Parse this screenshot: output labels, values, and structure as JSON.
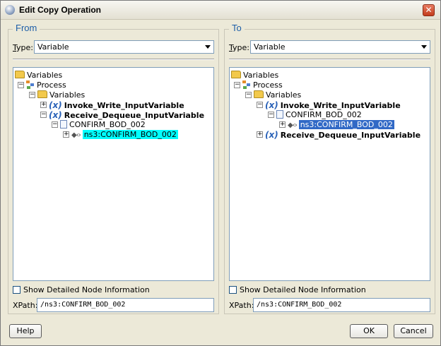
{
  "window": {
    "title": "Edit Copy Operation",
    "close_glyph": "✕"
  },
  "from": {
    "title": "From",
    "type_label": "Type:",
    "type_value": "Variable",
    "tree": {
      "variables_root": "Variables",
      "process": "Process",
      "variables": "Variables",
      "var1": "Invoke_Write_InputVariable",
      "var2": "Receive_Dequeue_InputVariable",
      "doc": "CONFIRM_BOD_002",
      "element": "ns3:CONFIRM_BOD_002"
    },
    "show_details_label": "Show Detailed Node Information",
    "xpath_label": "XPath:",
    "xpath_value": "/ns3:CONFIRM_BOD_002"
  },
  "to": {
    "title": "To",
    "type_label": "Type:",
    "type_value": "Variable",
    "tree": {
      "variables_root": "Variables",
      "process": "Process",
      "variables": "Variables",
      "var1": "Invoke_Write_InputVariable",
      "doc": "CONFIRM_BOD_002",
      "element": "ns3:CONFIRM_BOD_002",
      "var2": "Receive_Dequeue_InputVariable"
    },
    "show_details_label": "Show Detailed Node Information",
    "xpath_label": "XPath:",
    "xpath_value": "/ns3:CONFIRM_BOD_002"
  },
  "buttons": {
    "help": "Help",
    "ok": "OK",
    "cancel": "Cancel"
  },
  "icons": {
    "folder": "folder-icon",
    "process": "process-icon",
    "variable": "variable-icon",
    "document": "document-icon",
    "element": "element-icon"
  },
  "colors": {
    "panel_title": "#1d5ea8",
    "highlight_from": "#00ffff",
    "highlight_to": "#3169c6"
  }
}
